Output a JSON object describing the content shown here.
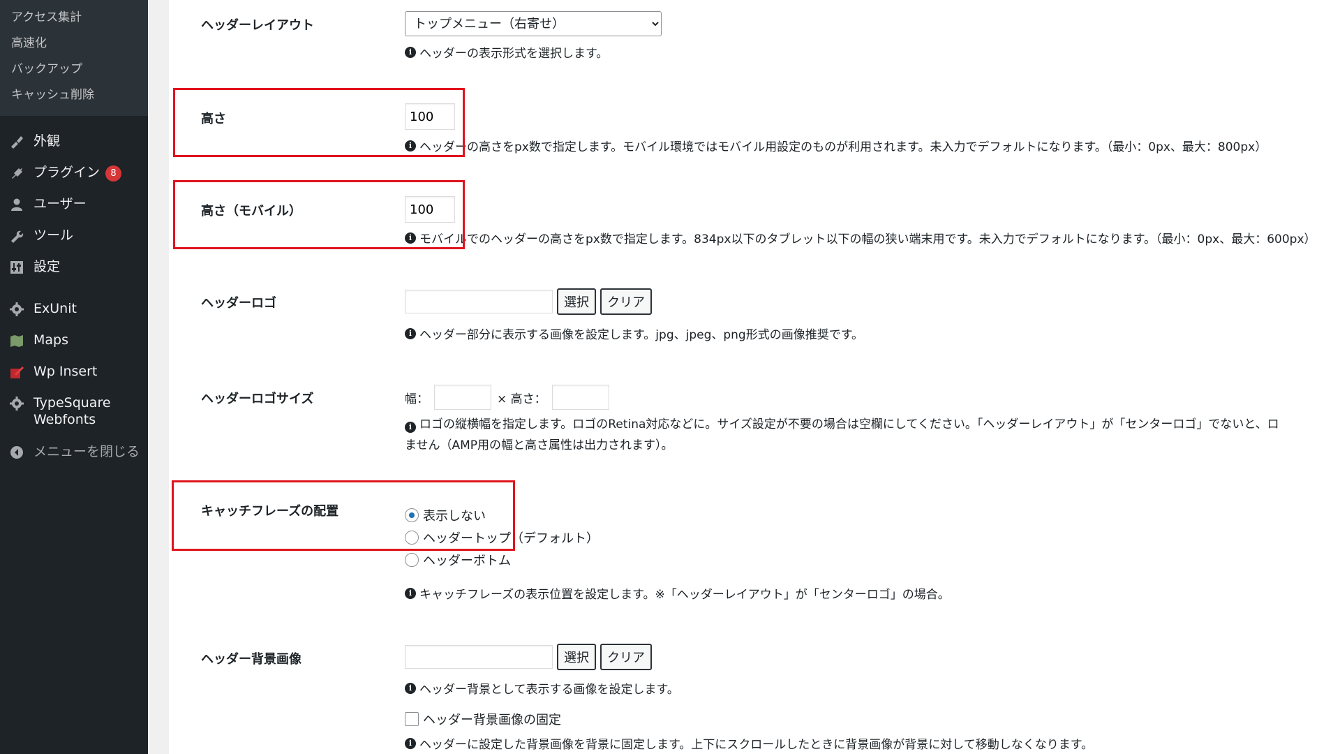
{
  "sidebar": {
    "submenu": [
      "アクセス集計",
      "高速化",
      "バックアップ",
      "キャッシュ削除"
    ],
    "appearance": "外観",
    "plugins": "プラグイン",
    "plugins_badge": "8",
    "users": "ユーザー",
    "tools": "ツール",
    "settings": "設定",
    "exunit": "ExUnit",
    "maps": "Maps",
    "wp_insert": "Wp Insert",
    "typesquare": "TypeSquare\nWebfonts",
    "close_menu": "メニューを閉じる"
  },
  "form": {
    "header_layout": {
      "label": "ヘッダーレイアウト",
      "selected": "トップメニュー（右寄せ）",
      "desc": "ヘッダーの表示形式を選択します。"
    },
    "height": {
      "label": "高さ",
      "value": "100",
      "desc": "ヘッダーの高さをpx数で指定します。モバイル環境ではモバイル用設定のものが利用されます。未入力でデフォルトになります。（最小：0px、最大：800px）"
    },
    "height_mobile": {
      "label": "高さ（モバイル）",
      "value": "100",
      "desc": "モバイルでのヘッダーの高さをpx数で指定します。834px以下のタブレット以下の幅の狭い端末用です。未入力でデフォルトになります。（最小：0px、最大：600px）"
    },
    "header_logo": {
      "label": "ヘッダーロゴ",
      "select_btn": "選択",
      "clear_btn": "クリア",
      "desc": "ヘッダー部分に表示する画像を設定します。jpg、jpeg、png形式の画像推奨です。"
    },
    "header_logo_size": {
      "label": "ヘッダーロゴサイズ",
      "width_label": "幅：",
      "height_label": "× 高さ：",
      "desc_line1": "ロゴの縦横幅を指定します。ロゴのRetina対応などに。サイズ設定が不要の場合は空欄にしてください。「ヘッダーレイアウト」が「センターロゴ」でないと、ロ",
      "desc_line2": "ません（AMP用の幅と高さ属性は出力されます）。"
    },
    "catchphrase": {
      "label": "キャッチフレーズの配置",
      "options": [
        "表示しない",
        "ヘッダートップ（デフォルト）",
        "ヘッダーボトム"
      ],
      "desc": "キャッチフレーズの表示位置を設定します。※「ヘッダーレイアウト」が「センターロゴ」の場合。"
    },
    "header_bg": {
      "label": "ヘッダー背景画像",
      "select_btn": "選択",
      "clear_btn": "クリア",
      "desc": "ヘッダー背景として表示する画像を設定します。",
      "fixed_label": "ヘッダー背景画像の固定",
      "fixed_desc": "ヘッダーに設定した背景画像を背景に固定します。上下にスクロールしたときに背景画像が背景に対して移動しなくなります。"
    }
  },
  "colors": {
    "sidebar_bg": "#1d2327",
    "submenu_bg": "#2c3338",
    "highlight": "#e0141e",
    "badge": "#d63638",
    "radio_checked": "#2271b1"
  }
}
